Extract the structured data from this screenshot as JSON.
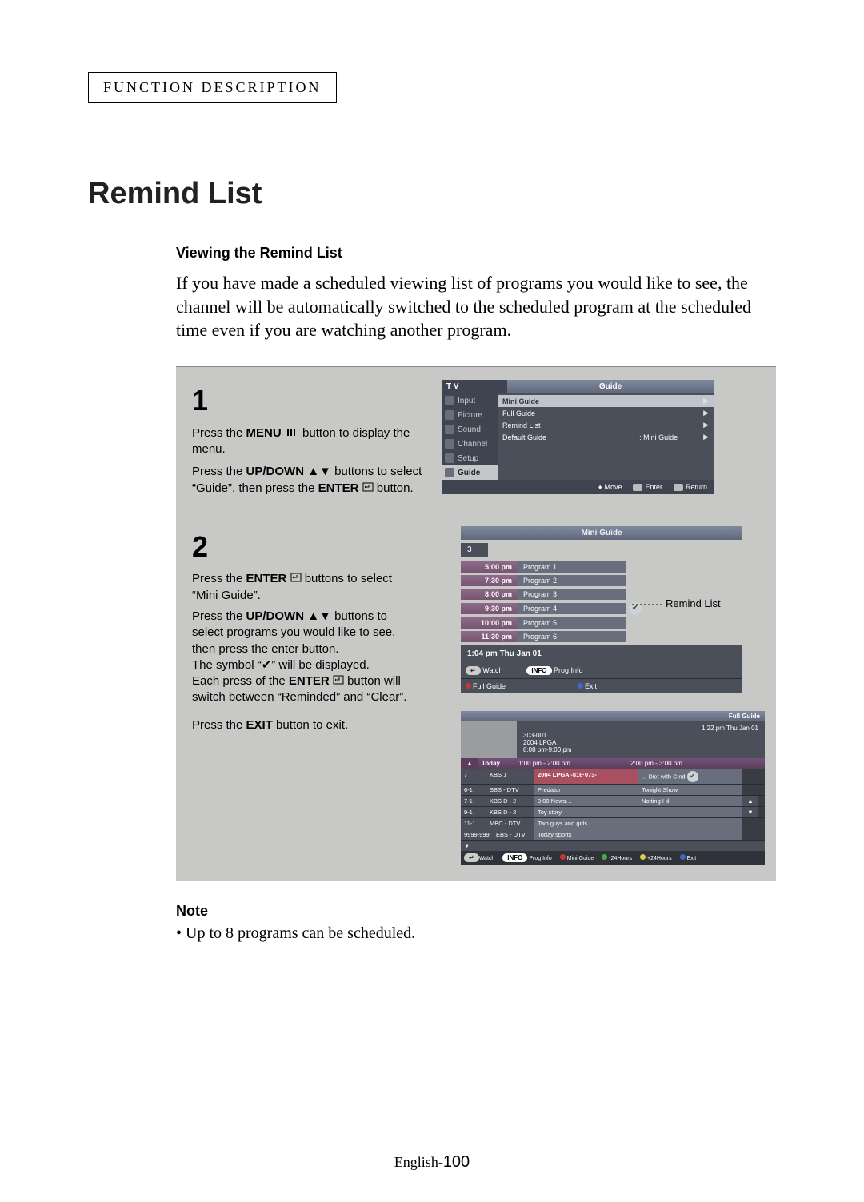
{
  "section_label": "FUNCTION DESCRIPTION",
  "title": "Remind List",
  "subtitle": "Viewing the Remind List",
  "intro": "If you have made a scheduled viewing list of programs you would like to see, the channel will be automatically switched to the scheduled program at the scheduled time even if you are watching another program.",
  "step1": {
    "num": "1",
    "p1a": "Press the ",
    "p1_menu": "MENU",
    "p1b": " button to display the menu.",
    "p2a": "Press the ",
    "p2_updown": "UP/DOWN",
    "p2b": " buttons to select “Guide”, then press the ",
    "p2_enter": "ENTER",
    "p2c": " button."
  },
  "step2": {
    "num": "2",
    "p1a": "Press the ",
    "p1_enter": "ENTER",
    "p1b": " buttons  to select “Mini Guide”.",
    "p2a": "Press the ",
    "p2_updown": "UP/DOWN",
    "p2b": " buttons to select programs you would like to see, then press the enter button.",
    "p3": "The symbol “✔” will be displayed.",
    "p4a": "Each press of the ",
    "p4_enter": "ENTER",
    "p4b": " button will switch between “Reminded” and “Clear”.",
    "p5a": "Press the ",
    "p5_exit": "EXIT",
    "p5b": " button to exit."
  },
  "osd1": {
    "tv": "T V",
    "title": "Guide",
    "side": [
      "Input",
      "Picture",
      "Sound",
      "Channel",
      "Setup",
      "Guide"
    ],
    "items": [
      {
        "label": "Mini Guide",
        "val": ""
      },
      {
        "label": "Full Guide",
        "val": ""
      },
      {
        "label": "Remind List",
        "val": ""
      },
      {
        "label": "Default Guide",
        "val": ": Mini Guide"
      }
    ],
    "footer": {
      "move": "Move",
      "enter": "Enter",
      "return": "Return"
    }
  },
  "osd2": {
    "title": "Mini Guide",
    "channel": "3",
    "rows": [
      {
        "t": "5:00 pm",
        "p": "Program 1"
      },
      {
        "t": "7:30 pm",
        "p": "Program 2"
      },
      {
        "t": "8:00 pm",
        "p": "Program 3"
      },
      {
        "t": "9:30 pm",
        "p": "Program 4",
        "chk": true
      },
      {
        "t": "10:00 pm",
        "p": "Program 5"
      },
      {
        "t": "11:30 pm",
        "p": "Program 6"
      }
    ],
    "now": "1:04 pm Thu Jan 01",
    "foot": {
      "watch": "Watch",
      "info": "INFO",
      "proginfo": "Prog Info",
      "full": "Full Guide",
      "exit": "Exit"
    },
    "callout": "Remind List"
  },
  "fullguide": {
    "title": "Full Guide",
    "now": "1:22 pm Thu Jan 01",
    "meta": {
      "ch": "303-001",
      "name": "2004 LPGA",
      "time": "8:08 pm-9:00 pm"
    },
    "head": {
      "c1": "Today",
      "c2": "1:00 pm - 2:00 pm",
      "c3": "2:00 pm - 3:00 pm"
    },
    "rows": [
      {
        "ch": "7",
        "nm": "KBS 1",
        "p1": "2004 LPGA -816·073- ",
        "p2": "... Diet with Cind",
        "hot": true,
        "chk": true
      },
      {
        "ch": "6-1",
        "nm": "SBS - DTV",
        "p1": "Predator",
        "p2": "Tonight Show"
      },
      {
        "ch": "7-1",
        "nm": "KBS D - 2",
        "p1": "9:00 News…",
        "p2": "Notting Hill"
      },
      {
        "ch": "9-1",
        "nm": "KBS D - 2",
        "p1": "Toy story",
        "p2": ""
      },
      {
        "ch": "11-1",
        "nm": "MBC - DTV",
        "p1": "Two guys and  girls",
        "p2": ""
      },
      {
        "ch": "9999-999",
        "nm": "EBS - DTV",
        "p1": "Today sports",
        "p2": ""
      }
    ],
    "foot": {
      "watch": "Watch",
      "info": "INFO",
      "prog": "Prog Info",
      "mini": "Mini Guide",
      "m24": "-24Hours",
      "p24": "+24Hours",
      "exit": "Exit"
    }
  },
  "note_h": "Note",
  "note": "• Up to 8 programs can be scheduled.",
  "pagefoot": {
    "lang": "English-",
    "num": "100"
  }
}
